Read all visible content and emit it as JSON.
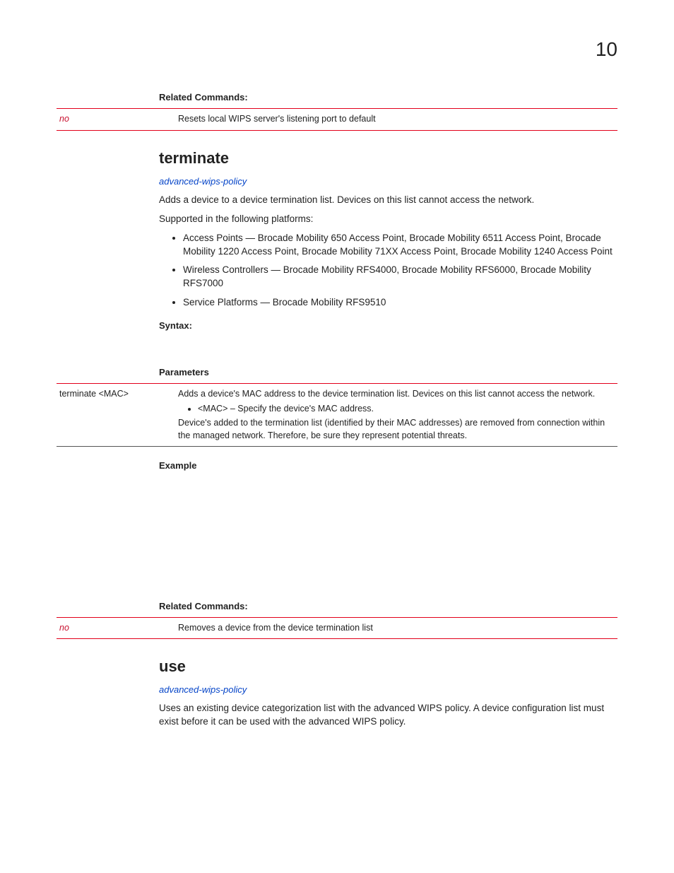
{
  "chapter": "10",
  "sec_related": "Related Commands:",
  "table1": {
    "cmd": "no",
    "desc": "Resets local WIPS server's listening port to default"
  },
  "terminate": {
    "title": "terminate",
    "policy": "advanced-wips-policy",
    "intro": "Adds a device to a device termination list. Devices on this list cannot access the network.",
    "supported": "Supported in the following platforms:",
    "platforms": [
      "Access Points — Brocade Mobility 650 Access Point, Brocade Mobility 6511 Access Point, Brocade Mobility 1220 Access Point, Brocade Mobility 71XX Access Point, Brocade Mobility 1240 Access Point",
      "Wireless Controllers — Brocade Mobility RFS4000, Brocade Mobility RFS6000, Brocade Mobility RFS7000",
      "Service Platforms — Brocade Mobility RFS9510"
    ],
    "syntax_h": "Syntax:",
    "params_h": "Parameters",
    "param_row": {
      "left": "terminate <MAC>",
      "d1": "Adds a device's MAC address to the device termination list. Devices on this list cannot access the network.",
      "bullet": "<MAC> – Specify the device's MAC address.",
      "d2": "Device's added to the termination list (identified by their MAC addresses) are removed from connection within the managed network. Therefore, be sure they represent potential threats."
    },
    "example_h": "Example",
    "related_h": "Related Commands:",
    "related_row": {
      "cmd": "no",
      "desc": "Removes a device from the device termination list"
    }
  },
  "use": {
    "title": "use",
    "policy": "advanced-wips-policy",
    "intro": "Uses an existing device categorization list with the advanced WIPS policy. A device configuration list must exist before it can be used with the advanced WIPS policy."
  }
}
